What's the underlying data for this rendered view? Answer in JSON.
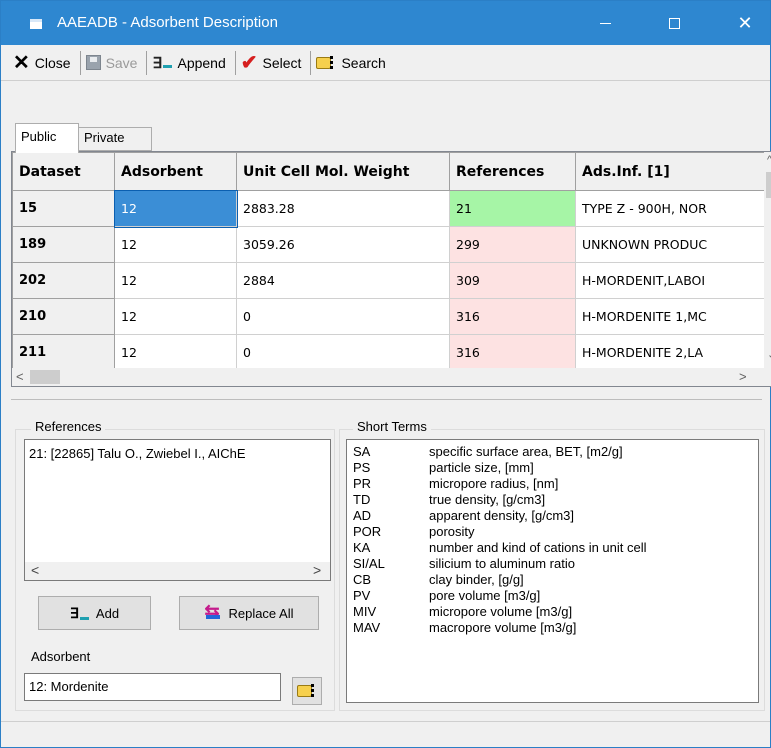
{
  "window": {
    "title": "AAEADB - Adsorbent Description",
    "minimize": "—",
    "maximize": "☐",
    "close": "✕"
  },
  "toolbar": {
    "close_label": "Close",
    "save_label": "Save",
    "append_label": "Append",
    "select_label": "Select",
    "search_label": "Search"
  },
  "tabs": [
    {
      "label": "Public",
      "active": true
    },
    {
      "label": "Private",
      "active": false
    }
  ],
  "grid": {
    "columns": [
      "Dataset",
      "Adsorbent",
      "Unit Cell Mol. Weight",
      "References",
      "Ads.Inf. [1]"
    ],
    "rows": [
      [
        "15",
        "12",
        "2883.28",
        "21",
        "TYPE Z - 900H, NOR"
      ],
      [
        "189",
        "12",
        "3059.26",
        "299",
        "UNKNOWN PRODUC"
      ],
      [
        "202",
        "12",
        "2884",
        "309",
        "H-MORDENIT,LABOI"
      ],
      [
        "210",
        "12",
        "0",
        "316",
        "H-MORDENITE 1,MC"
      ],
      [
        "211",
        "12",
        "0",
        "316",
        "H-MORDENITE 2,LA"
      ]
    ],
    "scroll_up": "^",
    "scroll_down": "⌄",
    "scroll_left": "<",
    "scroll_right": ">"
  },
  "references": {
    "label": "References",
    "items": [
      "21: [22865] Talu O., Zwiebel I., AIChE"
    ],
    "scroll_left": "<",
    "scroll_right": ">",
    "add_label": "Add",
    "replace_all_label": "Replace All"
  },
  "adsorbent": {
    "label": "Adsorbent",
    "value": "12: Mordenite"
  },
  "short_terms": {
    "label": "Short Terms",
    "items": [
      {
        "abbr": "SA",
        "desc": "specific surface area, BET, [m2/g]"
      },
      {
        "abbr": "PS",
        "desc": "particle size, [mm]"
      },
      {
        "abbr": "PR",
        "desc": "micropore radius, [nm]"
      },
      {
        "abbr": "TD",
        "desc": "true density, [g/cm3]"
      },
      {
        "abbr": "AD",
        "desc": "apparent density, [g/cm3]"
      },
      {
        "abbr": "POR",
        "desc": "porosity"
      },
      {
        "abbr": "KA",
        "desc": "number and kind of cations in unit cell"
      },
      {
        "abbr": "SI/AL",
        "desc": "silicium to aluminum ratio"
      },
      {
        "abbr": "CB",
        "desc": "clay binder, [g/g]"
      },
      {
        "abbr": "PV",
        "desc": "pore volume [m3/g]"
      },
      {
        "abbr": "MIV",
        "desc": "micropore volume [m3/g]"
      },
      {
        "abbr": "MAV",
        "desc": "macropore volume [m3/g]"
      }
    ]
  },
  "colors": {
    "titlebar": "#2e87d0",
    "selected_cell": "#3b8ed6",
    "reference_match": "#a6f5a6",
    "reference_other": "#fde2e2"
  }
}
